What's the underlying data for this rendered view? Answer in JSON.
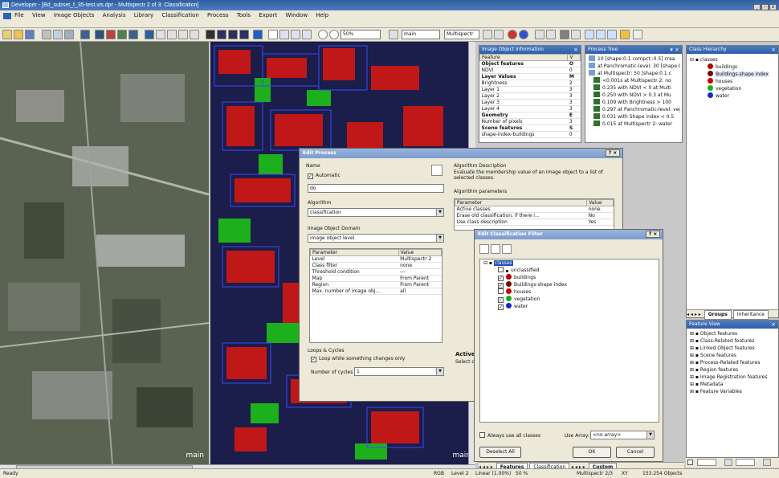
{
  "window": {
    "title": "Developer - [Bd_subset_f_35-test.vis.dpr - Multispectr 2 of 3: Classification]"
  },
  "menu": [
    "File",
    "View",
    "Image Objects",
    "Analysis",
    "Library",
    "Classification",
    "Process",
    "Tools",
    "Export",
    "Window",
    "Help"
  ],
  "toolbar": {
    "zoom": "50%",
    "map": "main",
    "layer": "Multispectr"
  },
  "views": {
    "left_label": "main",
    "right_label": "main"
  },
  "image_object_info": {
    "title": "Image Object Information",
    "col_feature": "Feature",
    "col_value": "V",
    "rows": [
      {
        "f": "Object features",
        "v": "O",
        "bold": true
      },
      {
        "f": "NDVI",
        "v": "0",
        "bold": false
      },
      {
        "f": "Layer Values",
        "v": "M",
        "bold": true
      },
      {
        "f": "Brightness",
        "v": "2",
        "bold": false
      },
      {
        "f": "Layer 1",
        "v": "3",
        "bold": false
      },
      {
        "f": "Layer 2",
        "v": "3",
        "bold": false
      },
      {
        "f": "Layer 3",
        "v": "3",
        "bold": false
      },
      {
        "f": "Layer 4",
        "v": "3",
        "bold": false
      },
      {
        "f": "Geometry",
        "v": "E",
        "bold": true
      },
      {
        "f": "Number of pixels",
        "v": "3",
        "bold": false
      },
      {
        "f": "Scene features",
        "v": "S",
        "bold": true
      },
      {
        "f": "shape-index-buildings",
        "v": "0",
        "bold": false
      }
    ]
  },
  "process_tree": {
    "title": "Process Tree",
    "items": [
      "10 [shape:0.1 compct.:0.5] crea",
      "at  Panchromatic-level: 30 [shape:0",
      "at  Multispectr: 50 [shape:0.1 c",
      "<0.001s  at  Multispectr 2: no",
      "0.235  with NDVI < 0  at  Multi",
      "0.250  with NDVI > 0.3  at  Mu",
      "0.109  with Brightness > 100",
      "0.297  at  Panchromatic-level: veg",
      "0.031  with Shape index < 0.5",
      "0.015  at  Multispectr 2: water"
    ]
  },
  "class_hierarchy": {
    "title": "Class Hierarchy",
    "root": "classes",
    "items": [
      {
        "label": "buildings",
        "color": "#b00000"
      },
      {
        "label": "Buildings-shape index",
        "color": "#7a0000"
      },
      {
        "label": "houses",
        "color": "#cc0000"
      },
      {
        "label": "vegetation",
        "color": "#18b018"
      },
      {
        "label": "water",
        "color": "#1028d0"
      }
    ],
    "tabs": [
      "Groups",
      "Inheritance"
    ]
  },
  "feature_view": {
    "title": "Feature View",
    "items": [
      "Object features",
      "Class-Related features",
      "Linked Object features",
      "Scene features",
      "Process-Related features",
      "Region features",
      "Image Registration features",
      "Metadata",
      "Feature Variables"
    ]
  },
  "bottom_tabs": {
    "left": [
      "Features",
      "Classification"
    ],
    "right": [
      "Custom"
    ]
  },
  "edit_process": {
    "title": "Edit Process",
    "help": "?",
    "name_label": "Name",
    "automatic_label": "Automatic",
    "name_value": "do",
    "algorithm_label": "Algorithm",
    "algorithm_value": "classification",
    "domain_label": "Image Object Domain",
    "domain_value": "image object level",
    "param_col": "Parameter",
    "value_col": "Value",
    "domain_params": [
      {
        "p": "Level",
        "v": "Multispectr 2"
      },
      {
        "p": "Class filter",
        "v": "none"
      },
      {
        "p": "Threshold condition",
        "v": "---"
      },
      {
        "p": "Map",
        "v": "From Parent"
      },
      {
        "p": "Region",
        "v": "From Parent"
      },
      {
        "p": "Max. number of image obj...",
        "v": "all"
      }
    ],
    "loops_label": "Loops & Cycles",
    "loop_while_label": "Loop while something changes only",
    "cycles_label": "Number of cycles",
    "cycles_value": "1",
    "algo_desc_label": "Algorithm Description",
    "algo_desc": "Evaluate the membership value of an image object to a list of selected classes.",
    "algo_params_label": "Algorithm parameters",
    "algo_params": [
      {
        "p": "Active classes",
        "v": "none"
      },
      {
        "p": "Erase old classification, if there i...",
        "v": "No"
      },
      {
        "p": "Use class description",
        "v": "Yes"
      }
    ],
    "active_label": "Active",
    "select_label": "Select c"
  },
  "class_filter": {
    "title": "Edit Classification Filter",
    "help": "?",
    "root": "classes",
    "items": [
      {
        "label": "unclassified",
        "color": "",
        "checked": false
      },
      {
        "label": "buildings",
        "color": "#b00000",
        "checked": true
      },
      {
        "label": "Buildings-shape index",
        "color": "#7a0000",
        "checked": true
      },
      {
        "label": "houses",
        "color": "#cc0000",
        "checked": false
      },
      {
        "label": "vegetation",
        "color": "#18b018",
        "checked": true
      },
      {
        "label": "water",
        "color": "#1028d0",
        "checked": true
      }
    ],
    "always_use": "Always use all classes",
    "use_array": "Use Array:",
    "array_value": "<no array>",
    "deselect_all": "Deselect All",
    "ok": "OK",
    "cancel": "Cancel"
  },
  "status": {
    "left": "Ready",
    "items": [
      "RGB",
      "Level 2",
      "Linear (1.00%)",
      "50 %",
      "Multispectr 2/3",
      "XY",
      "153.254 Objects"
    ]
  }
}
